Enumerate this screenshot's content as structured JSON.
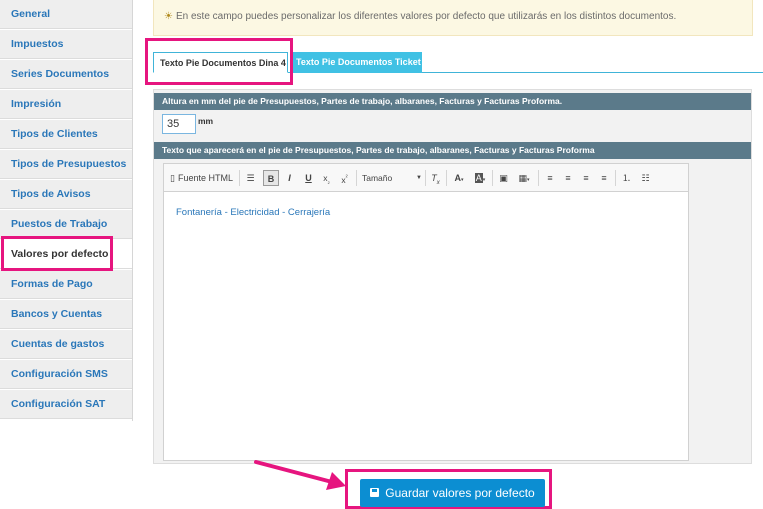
{
  "sidebar": {
    "items": [
      {
        "label": "General"
      },
      {
        "label": "Impuestos"
      },
      {
        "label": "Series Documentos"
      },
      {
        "label": "Impresión"
      },
      {
        "label": "Tipos de Clientes"
      },
      {
        "label": "Tipos de Presupuestos"
      },
      {
        "label": "Tipos de Avisos"
      },
      {
        "label": "Puestos de Trabajo"
      },
      {
        "label": "Valores por defecto"
      },
      {
        "label": "Formas de Pago"
      },
      {
        "label": "Bancos y Cuentas"
      },
      {
        "label": "Cuentas de gastos"
      },
      {
        "label": "Configuración SMS"
      },
      {
        "label": "Configuración SAT"
      }
    ],
    "active_index": 8
  },
  "info": {
    "text": "En este campo puedes personalizar los diferentes valores por defecto que utilizarás en los distintos documentos."
  },
  "tabs": [
    {
      "label": "Texto Pie Documentos Dina 4",
      "active": true
    },
    {
      "label": "Texto Pie Documentos Ticket",
      "active": false
    }
  ],
  "panel": {
    "height_header": "Altura en mm del pie de Presupuestos, Partes de trabajo, albaranes, Facturas y Facturas Proforma.",
    "height_value": "35",
    "height_unit": "mm",
    "text_header": "Texto que aparecerá en el pie de Presupuestos, Partes de trabajo, albaranes, Facturas y Facturas Proforma"
  },
  "editor": {
    "toolbar": {
      "source_label": "Fuente HTML",
      "bold": "B",
      "italic": "I",
      "underline": "U",
      "size_label": "Tamaño"
    },
    "content": "Fontanería - Electricidad - Cerrajería"
  },
  "save_button": {
    "label": "Guardar valores por defecto"
  },
  "colors": {
    "highlight": "#e6157f",
    "link": "#2a77b9",
    "tab_active_border": "#40b4d8",
    "button": "#0c8ed2",
    "panel_header": "#5b7a8a"
  }
}
